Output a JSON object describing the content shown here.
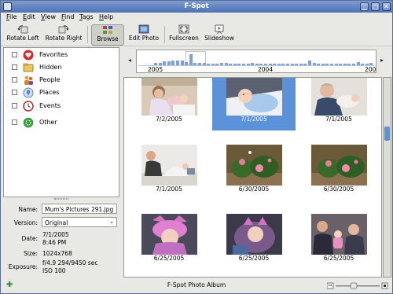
{
  "window": {
    "title": "F-Spot"
  },
  "menu": [
    {
      "label": "File",
      "u": "F",
      "rest": "ile"
    },
    {
      "label": "Edit",
      "u": "E",
      "rest": "dit"
    },
    {
      "label": "View",
      "u": "V",
      "rest": "iew"
    },
    {
      "label": "Find",
      "u": "F",
      "rest": "ind"
    },
    {
      "label": "Tags",
      "u": "T",
      "rest": "ags"
    },
    {
      "label": "Help",
      "u": "H",
      "rest": "elp"
    }
  ],
  "toolbar": {
    "rotate_left": "Rotate Left",
    "rotate_right": "Rotate Right",
    "browse": "Browse",
    "edit_photo": "Edit Photo",
    "fullscreen": "Fullscreen",
    "slideshow": "Slideshow"
  },
  "tags": [
    {
      "label": "Favorites",
      "icon": "heart-icon",
      "color": "#d9262b"
    },
    {
      "label": "Hidden",
      "icon": "hidden-icon",
      "color": "#c79a2a"
    },
    {
      "label": "People",
      "icon": "people-icon",
      "color": "#d48a1a"
    },
    {
      "label": "Places",
      "icon": "places-icon",
      "color": "#5b82c2"
    },
    {
      "label": "Events",
      "icon": "events-icon",
      "color": "#b03020"
    },
    {
      "label": "Other",
      "icon": "other-icon",
      "color": "#3a9a3a"
    }
  ],
  "properties": {
    "name_label": "Name:",
    "name_value": "Mum's Pictures 291.jpg",
    "version_label": "Version:",
    "version_value": "Original",
    "date_label": "Date:",
    "date_value": "7/1/2005",
    "time_value": "8:46 PM",
    "size_label": "Size:",
    "size_value": "1024x768",
    "exposure_label": "Exposure:",
    "exposure_value": "f/4.9 294/9450 sec",
    "iso_value": "ISO 100"
  },
  "timeline": {
    "years": [
      "2005",
      "2004",
      "200"
    ],
    "prev_arrow": "◂",
    "next_arrow": "▸"
  },
  "photos": [
    {
      "date": "7/2/2005",
      "selected": false,
      "scene": "mother-baby"
    },
    {
      "date": "7/1/2005",
      "selected": true,
      "scene": "baby-sleeping"
    },
    {
      "date": "7/1/2005",
      "selected": false,
      "scene": "man-baby"
    },
    {
      "date": "7/1/2005",
      "selected": false,
      "scene": "man-bed"
    },
    {
      "date": "6/30/2005",
      "selected": false,
      "scene": "roses"
    },
    {
      "date": "6/30/2005",
      "selected": false,
      "scene": "roses"
    },
    {
      "date": "6/25/2005",
      "selected": false,
      "scene": "baby-hat"
    },
    {
      "date": "6/25/2005",
      "selected": false,
      "scene": "baby-carseat"
    },
    {
      "date": "6/25/2005",
      "selected": false,
      "scene": "family"
    }
  ],
  "status": {
    "text": "F-Spot Photo Album"
  },
  "colors": {
    "selection": "#5b92d9",
    "titlebar": "#4e72b5"
  }
}
